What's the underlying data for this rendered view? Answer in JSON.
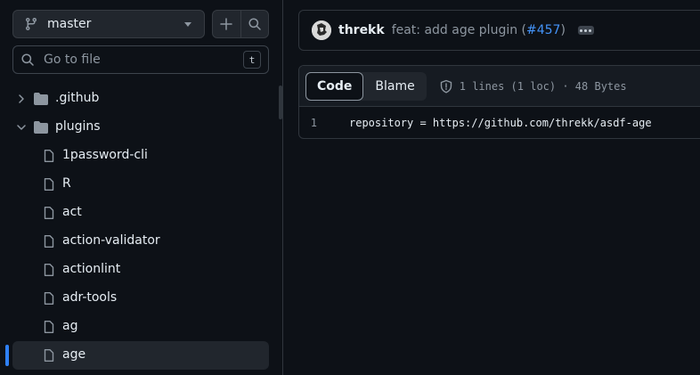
{
  "sidebar": {
    "branch": "master",
    "goto_placeholder": "Go to file",
    "goto_shortcut": "t",
    "tree": [
      {
        "label": ".github",
        "kind": "folder",
        "expanded": false,
        "depth": 0
      },
      {
        "label": "plugins",
        "kind": "folder",
        "expanded": true,
        "depth": 0
      },
      {
        "label": "1password-cli",
        "kind": "file",
        "depth": 1
      },
      {
        "label": "R",
        "kind": "file",
        "depth": 1
      },
      {
        "label": "act",
        "kind": "file",
        "depth": 1
      },
      {
        "label": "action-validator",
        "kind": "file",
        "depth": 1
      },
      {
        "label": "actionlint",
        "kind": "file",
        "depth": 1
      },
      {
        "label": "adr-tools",
        "kind": "file",
        "depth": 1
      },
      {
        "label": "ag",
        "kind": "file",
        "depth": 1
      },
      {
        "label": "age",
        "kind": "file",
        "depth": 1,
        "selected": true
      }
    ]
  },
  "commit": {
    "author": "threkk",
    "message_prefix": "feat: add age plugin (",
    "pr_link": "#457",
    "message_suffix": ")"
  },
  "file": {
    "tabs": [
      "Code",
      "Blame"
    ],
    "active_tab": "Code",
    "meta": "1 lines (1 loc) · 48 Bytes",
    "lines": [
      {
        "num": "1",
        "text": "repository = https://github.com/threkk/asdf-age"
      }
    ]
  },
  "colors": {
    "background": "#0d1117",
    "accent": "#2f81f7",
    "link": "#4493f8"
  }
}
